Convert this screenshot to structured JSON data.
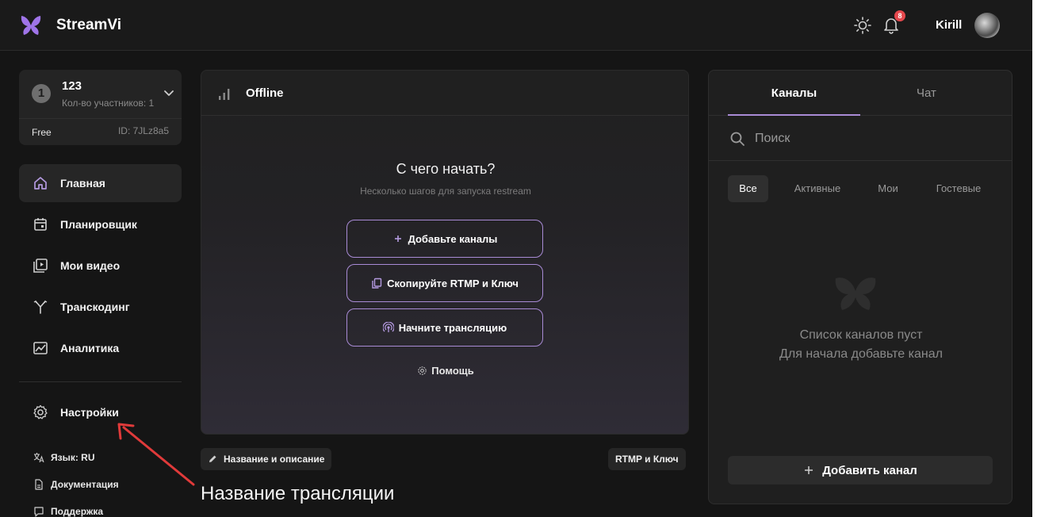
{
  "header": {
    "brand": "StreamVi",
    "notifications_count": "8",
    "username": "Kirill",
    "icons": [
      "logo-icon",
      "sun-icon",
      "bell-icon"
    ]
  },
  "project": {
    "number": "1",
    "name": "123",
    "members": "Кол-во участников: 1",
    "plan": "Free",
    "id": "ID: 7JLz8a5"
  },
  "sidebar": {
    "items": [
      {
        "label": "Главная",
        "icon": "home-icon",
        "active": true
      },
      {
        "label": "Планировщик",
        "icon": "calendar-icon"
      },
      {
        "label": "Мои видео",
        "icon": "video-library-icon"
      },
      {
        "label": "Транскодинг",
        "icon": "transcoding-icon"
      },
      {
        "label": "Аналитика",
        "icon": "analytics-icon"
      }
    ],
    "settings": "Настройки",
    "language": "Язык: RU",
    "docs": "Документация",
    "support": "Поддержка"
  },
  "stream": {
    "status": "Offline",
    "title": "С чего начать?",
    "subtitle": "Несколько шагов для запуска restream",
    "buttons": [
      "Добавьте каналы",
      "Скопируйте RTMP и Ключ",
      "Начните трансляцию"
    ],
    "help": "Помощь",
    "chip_left": "Название и описание",
    "chip_right": "RTMP и Ключ",
    "stream_title": "Название трансляции"
  },
  "right_panel": {
    "tabs": [
      "Каналы",
      "Чат"
    ],
    "search_placeholder": "Поиск",
    "filters": [
      "Все",
      "Активные",
      "Мои",
      "Гостевые"
    ],
    "empty_line1": "Список каналов пуст",
    "empty_line2": "Для начала добавьте канал",
    "add_channel": "Добавить канал"
  },
  "colors": {
    "accent": "#a98bd6",
    "background": "#151515",
    "panel": "#1f1f1f",
    "badge": "#e5484d",
    "annotation_arrow": "#e03a3a"
  }
}
